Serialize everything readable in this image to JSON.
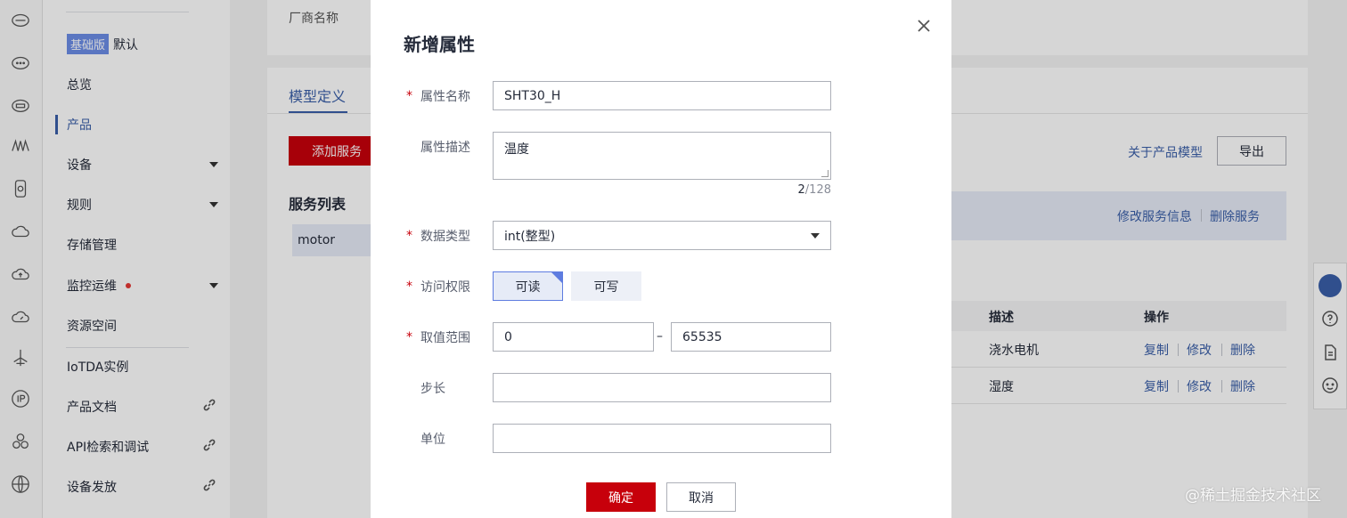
{
  "sidebar": {
    "edition_badge": "基础版",
    "edition_default": "默认",
    "items": [
      {
        "label": "总览"
      },
      {
        "label": "产品"
      },
      {
        "label": "设备"
      },
      {
        "label": "规则"
      },
      {
        "label": "存储管理"
      },
      {
        "label": "监控运维"
      },
      {
        "label": "资源空间"
      },
      {
        "label": "IoTDA实例"
      },
      {
        "label": "产品文档"
      },
      {
        "label": "API检索和调试"
      },
      {
        "label": "设备发放"
      }
    ]
  },
  "background": {
    "vendor_label": "厂商名称",
    "tab_label": "模型定义",
    "add_service_label": "添加服务",
    "service_list_title": "服务列表",
    "service_item": "motor",
    "about_model_link": "关于产品模型",
    "export_label": "导出",
    "edit_service_info": "修改服务信息",
    "delete_service": "删除服务",
    "table_headers": {
      "desc": "描述",
      "ops": "操作"
    },
    "rows": [
      {
        "desc": "浇水电机",
        "copy": "复制",
        "edit": "修改",
        "delete": "删除"
      },
      {
        "desc": "湿度",
        "copy": "复制",
        "edit": "修改",
        "delete": "删除"
      }
    ]
  },
  "modal": {
    "title": "新增属性",
    "fields": {
      "name_label": "属性名称",
      "name_value": "SHT30_H",
      "desc_label": "属性描述",
      "desc_value": "温度",
      "desc_count": "2",
      "desc_max": "/128",
      "type_label": "数据类型",
      "type_value": "int(整型)",
      "access_label": "访问权限",
      "access_read": "可读",
      "access_write": "可写",
      "range_label": "取值范围",
      "range_min": "0",
      "range_dash": "–",
      "range_max": "65535",
      "step_label": "步长",
      "step_value": "",
      "unit_label": "单位",
      "unit_value": ""
    },
    "required_mark": "*",
    "ok_label": "确定",
    "cancel_label": "取消"
  },
  "watermark": "@稀土掘金技术社区"
}
